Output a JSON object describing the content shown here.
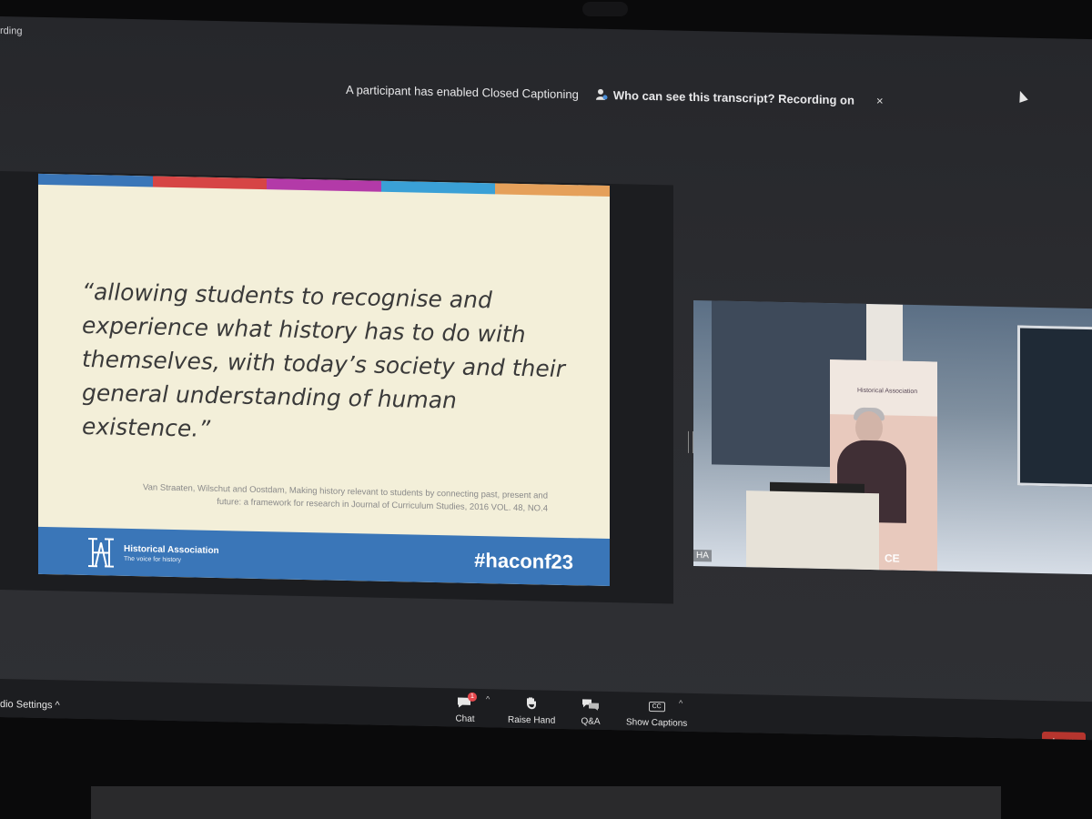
{
  "window": {
    "recording_text": "rding"
  },
  "cc_banner": {
    "message": "A participant has enabled Closed Captioning",
    "link": "Who can see this transcript? Recording on",
    "close": "×"
  },
  "slide": {
    "top_bar_colors": [
      "#3a76b8",
      "#d64545",
      "#b33aa8",
      "#3aa0d6",
      "#e5a05a"
    ],
    "quote": "“allowing students to recognise and experience what history has to do with themselves, with today’s society and their general understanding of human existence.”",
    "citation_line1": "Van Straaten, Wilschut and Oostdam, Making history relevant to students by connecting past, present and",
    "citation_line2": "future: a framework for research in Journal of Curriculum Studies, 2016 VOL. 48, NO.4",
    "org_name": "Historical Association",
    "org_tagline": "The voice for history",
    "hashtag": "#haconf23"
  },
  "video": {
    "participant_name": "HA",
    "banner_org": "Historical Association",
    "banner_visible_text": "CE"
  },
  "toolbar": {
    "audio_settings": "dio Settings",
    "chat": "Chat",
    "chat_badge": "1",
    "raise_hand": "Raise Hand",
    "qa": "Q&A",
    "show_captions": "Show Captions",
    "captions_icon": "CC",
    "leave": "Leave"
  },
  "colors": {
    "slide_bg": "#f3efd9",
    "slide_footer": "#3a76b8",
    "leave_button": "#b6352e"
  }
}
